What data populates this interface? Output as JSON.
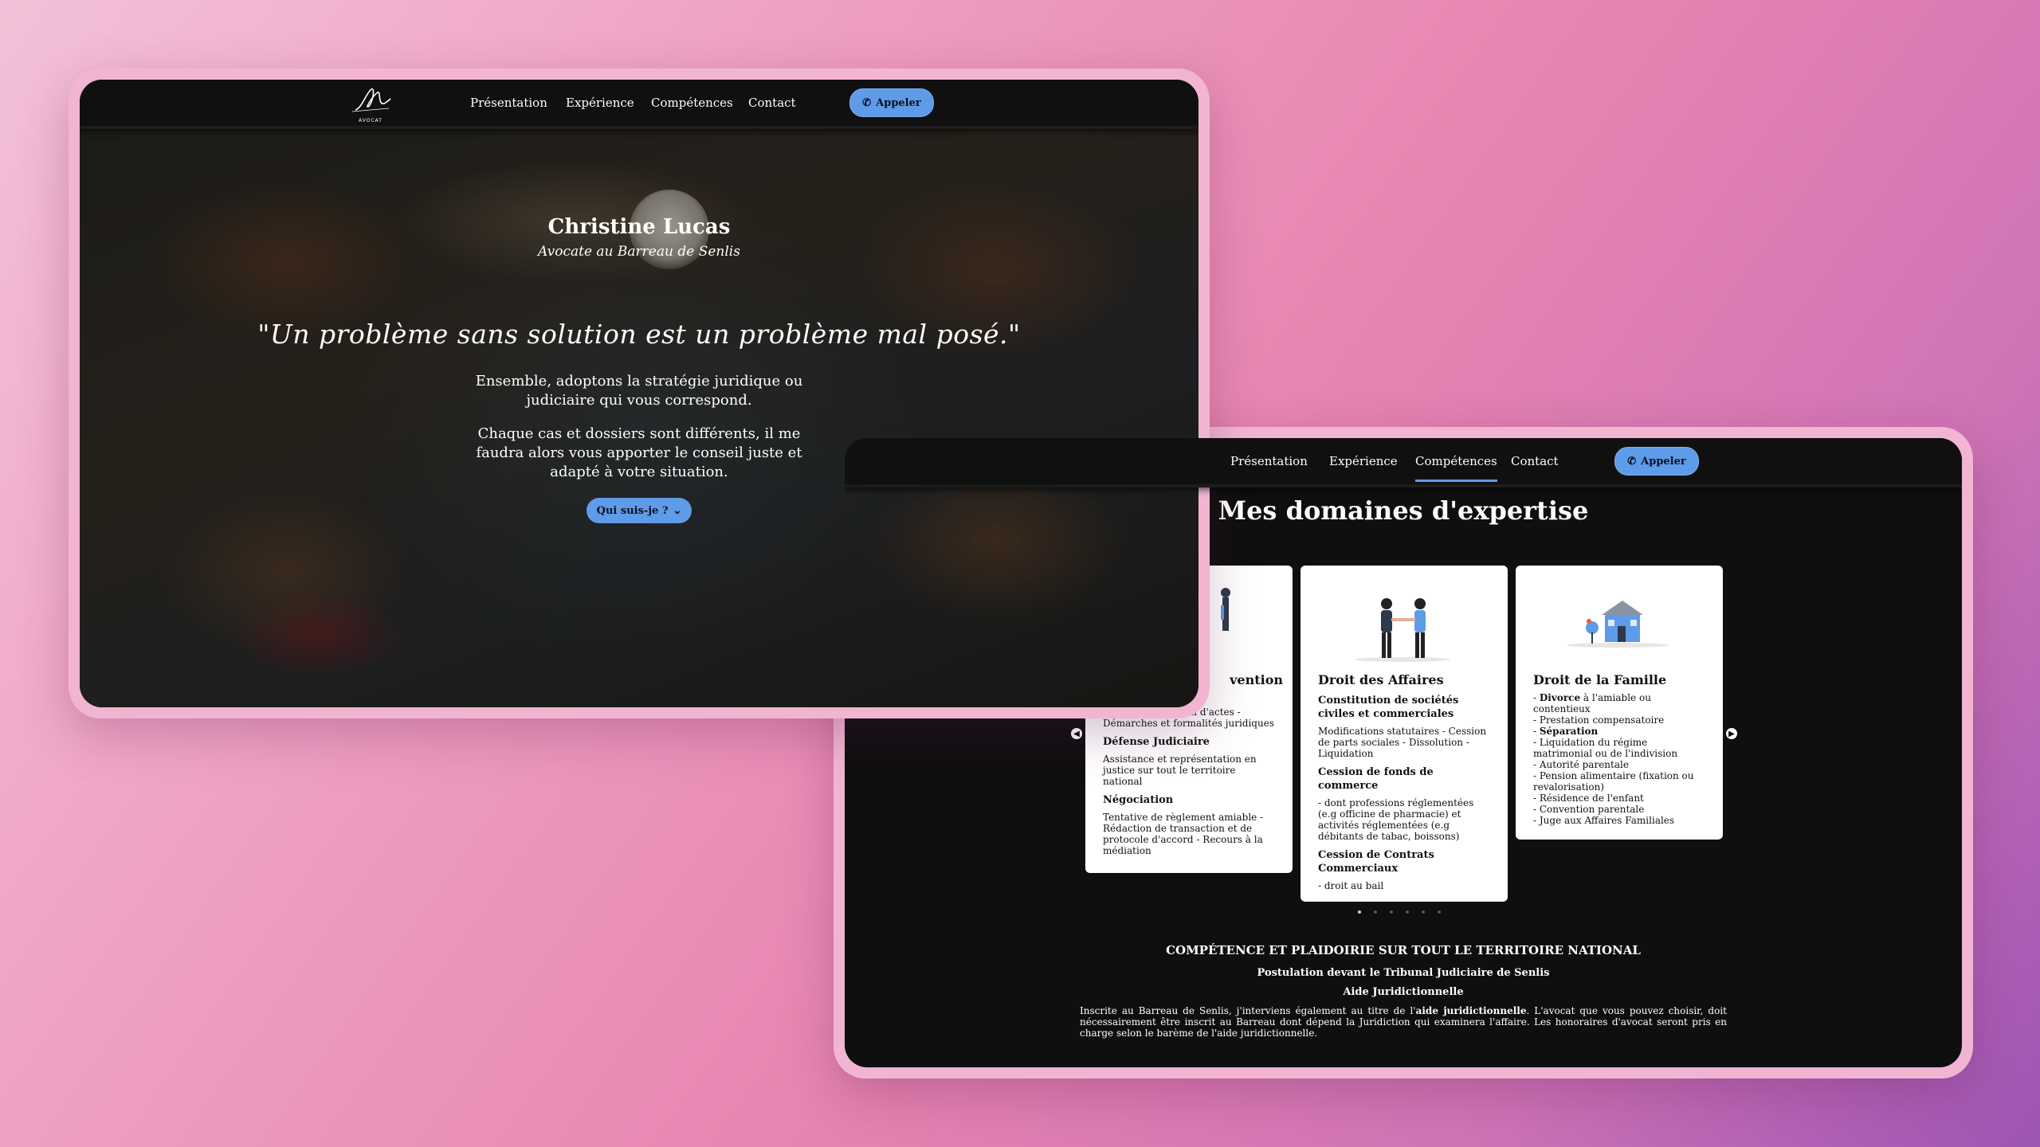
{
  "nav": {
    "logo_text": "AVOCAT",
    "links": [
      "Présentation",
      "Expérience",
      "Compétences",
      "Contact"
    ],
    "call_label": "Appeler"
  },
  "hero": {
    "name": "Christine Lucas",
    "subtitle": "Avocate au Barreau de Senlis",
    "quote": "\"Un problème sans solution est un problème mal posé.\"",
    "para1": "Ensemble, adoptons la stratégie juridique ou judiciaire qui vous correspond.",
    "para2": "Chaque cas et dossiers sont différents, il me faudra alors vous apporter le conseil juste et adapté à votre situation.",
    "button_label": "Qui suis-je ?"
  },
  "expertise": {
    "title": "Mes domaines d'expertise",
    "cards": [
      {
        "title": "vention",
        "blocks": [
          {
            "heading": "",
            "text": "Conseil - Rédaction d'actes - Démarches et formalités juridiques"
          },
          {
            "heading": "Défense Judiciaire",
            "text": "Assistance et représentation en justice sur tout le territoire national"
          },
          {
            "heading": "Négociation",
            "text": "Tentative de règlement amiable - Rédaction de transaction et de protocole d'accord - Recours à la médiation"
          }
        ]
      },
      {
        "title": "Droit des Affaires",
        "blocks": [
          {
            "heading": "Constitution de sociétés civiles et commerciales",
            "text": "Modifications statutaires - Cession de parts sociales - Dissolution - Liquidation"
          },
          {
            "heading": "Cession de fonds de commerce",
            "text": "- dont professions réglementées (e.g officine de pharmacie) et activités réglementées (e.g débitants de tabac, boissons)"
          },
          {
            "heading": "Cession de Contrats Commerciaux",
            "text": "- droit au bail"
          }
        ]
      },
      {
        "title": "Droit de la Famille",
        "items": [
          {
            "bold": "Divorce",
            "text": " à l'amiable ou contentieux"
          },
          {
            "bold": "",
            "text": "Prestation compensatoire"
          },
          {
            "bold": "Séparation",
            "text": ""
          },
          {
            "bold": "",
            "text": "Liquidation du régime matrimonial ou de l'indivision"
          },
          {
            "bold": "",
            "text": "Autorité parentale"
          },
          {
            "bold": "",
            "text": "Pension alimentaire (fixation ou revalorisation)"
          },
          {
            "bold": "",
            "text": "Résidence de l'enfant"
          },
          {
            "bold": "",
            "text": "Convention parentale"
          },
          {
            "bold": "",
            "text": "Juge aux Affaires Familiales"
          }
        ]
      }
    ],
    "dots": 6,
    "active_dot": 0
  },
  "footer": {
    "heading": "COMPÉTENCE ET PLAIDOIRIE SUR TOUT LE TERRITOIRE NATIONAL",
    "sub1": "Postulation devant le Tribunal Judiciaire de Senlis",
    "sub2": "Aide Juridictionnelle",
    "para_before": "Inscrite au Barreau de Senlis, j'interviens également au titre de l'",
    "para_bold": "aide juridictionnelle",
    "para_after": ". L'avocat que vous pouvez choisir, doit nécessairement être inscrit au Barreau dont dépend la Juridiction qui examinera l'affaire. Les honoraires d'avocat seront pris en charge selon le barème de l'aide juridictionnelle."
  },
  "colors": {
    "accent": "#5e9be8",
    "frame": "#f1b5d2",
    "dark": "#101010"
  }
}
